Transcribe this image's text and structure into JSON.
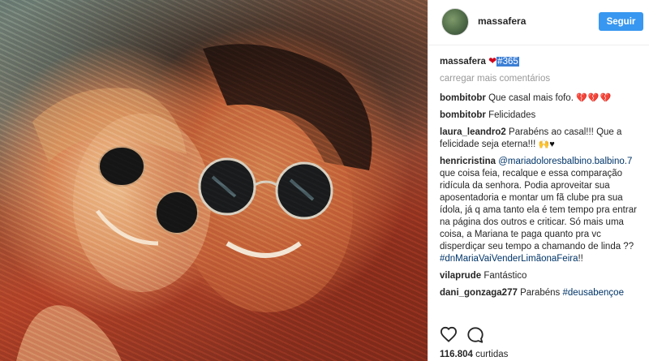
{
  "post": {
    "username": "massafera",
    "follow_label": "Seguir",
    "caption": {
      "user": "massafera",
      "heart": "❤",
      "tag": "#365"
    },
    "load_more": "carregar mais comentários",
    "comments": [
      {
        "user": "bombitobr",
        "text": "Que casal mais fofo.",
        "emoji": "💔💔💔"
      },
      {
        "user": "bombitobr",
        "text": "Felicidades"
      },
      {
        "user": "laura_leandro2",
        "text": "Parabéns ao casal!!! Que a felicidade seja eterna!!!",
        "emoji_hands": "🙌",
        "emoji_heart": "♥"
      },
      {
        "user": "henricristina",
        "mention": "@mariadoloresbalbino.balbino.7",
        "text": "que coisa feia, recalque e essa comparação ridícula da senhora. Podia aproveitar sua aposentadoria e montar um fã clube pra sua ídola, já q ama tanto ela é tem tempo pra entrar na página dos outros e criticar. Só mais uma coisa, a Mariana te paga quanto pra vc disperdiçar seu tempo a chamando de linda ??",
        "hashtag": "#dnMariaVaiVenderLimãonaFeira",
        "suffix": "!!"
      },
      {
        "user": "vilaprude",
        "text": "Fantástico"
      },
      {
        "user": "dani_gonzaga277",
        "text": "Parabéns",
        "hashtag": "#deusabençoe"
      }
    ],
    "likes": {
      "count": "116.804",
      "label": "curtidas"
    },
    "icons": [
      "heart-icon",
      "comment-icon"
    ]
  }
}
